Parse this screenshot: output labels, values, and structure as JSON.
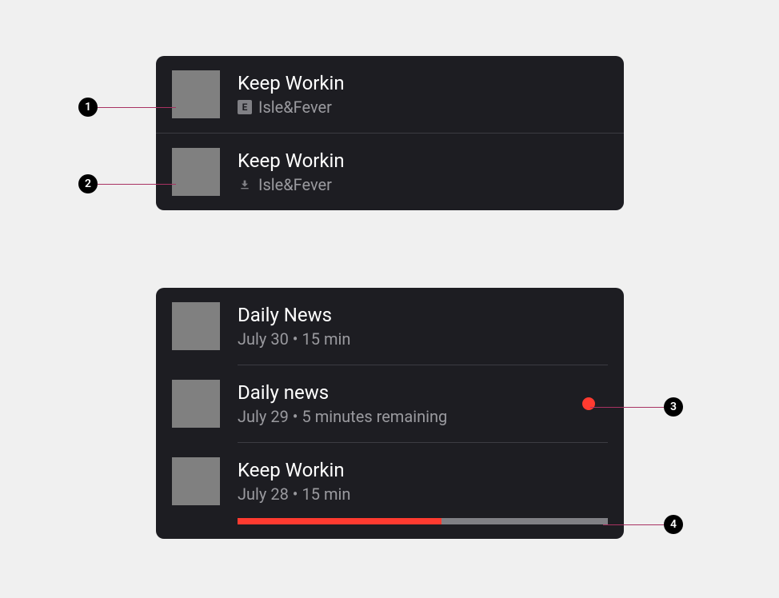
{
  "annotations": {
    "1": "1",
    "2": "2",
    "3": "3",
    "4": "4"
  },
  "tracks": [
    {
      "title": "Keep Workin",
      "artist": "Isle&Fever",
      "explicit_label": "E"
    },
    {
      "title": "Keep Workin",
      "artist": "Isle&Fever"
    }
  ],
  "episodes": [
    {
      "title": "Daily News",
      "meta": "July 30 • 15 min"
    },
    {
      "title": "Daily news",
      "meta": "July 29 • 5 minutes remaining"
    },
    {
      "title": "Keep Workin",
      "meta": "July 28 • 15 min",
      "progress_percent": 55
    }
  ]
}
